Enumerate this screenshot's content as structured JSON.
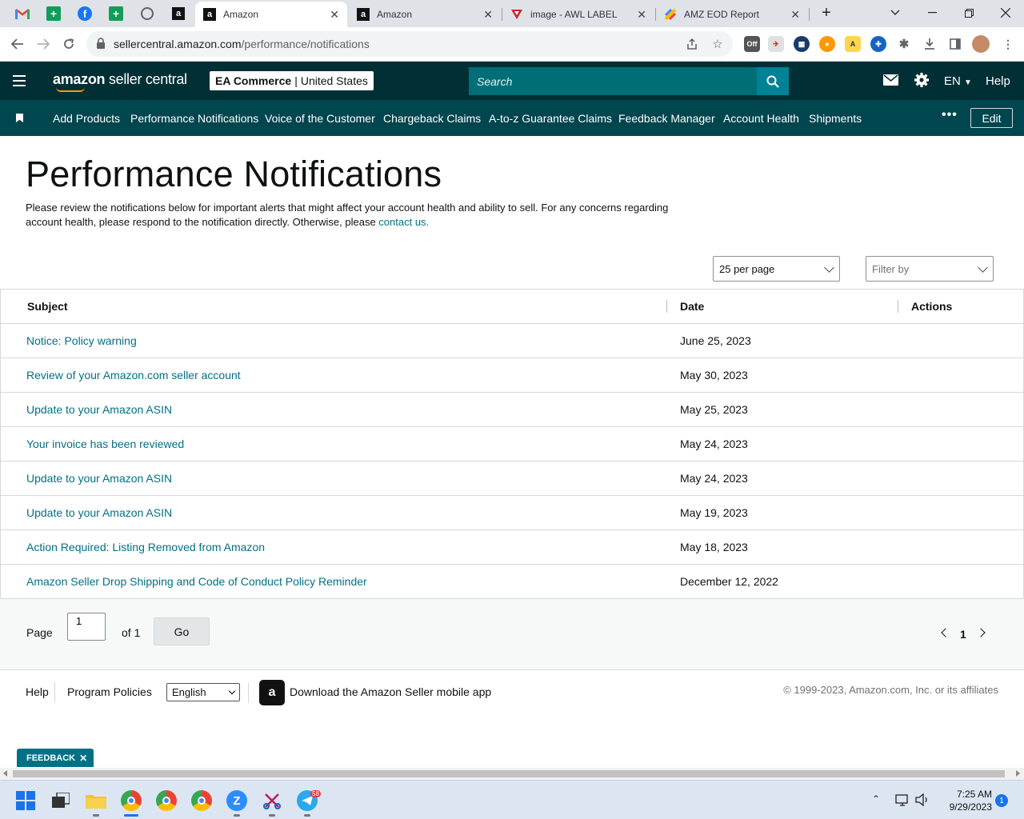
{
  "browser": {
    "tabs": [
      {
        "label": "Amazon",
        "active": true
      },
      {
        "label": "Amazon",
        "active": false
      },
      {
        "label": "image - AWL LABEL",
        "active": false
      },
      {
        "label": "AMZ EOD Report",
        "active": false
      }
    ],
    "url_host": "sellercentral.amazon.com",
    "url_path": "/performance/notifications"
  },
  "header": {
    "logo_word1": "amazon",
    "logo_word2": " seller central",
    "store_name": "EA Commerce",
    "store_sep": "|",
    "store_region": "United States",
    "search_placeholder": "Search",
    "language": "EN",
    "help": "Help"
  },
  "nav": {
    "items": [
      "Add Products",
      "Performance Notifications",
      "Voice of the Customer",
      "Chargeback Claims",
      "A-to-z Guarantee Claims",
      "Feedback Manager",
      "Account Health",
      "Shipments"
    ],
    "more": "•••",
    "edit": "Edit"
  },
  "main": {
    "title": "Performance Notifications",
    "intro_text": "Please review the notifications below for important alerts that might affect your account health and ability to sell. For any concerns regarding account health, please respond to the notification directly. Otherwise, please ",
    "intro_link": "contact us.",
    "per_page": "25 per page",
    "filter_placeholder": "Filter by",
    "columns": {
      "subject": "Subject",
      "date": "Date",
      "actions": "Actions"
    },
    "rows": [
      {
        "subject": "Notice: Policy warning",
        "date": "June 25, 2023"
      },
      {
        "subject": "Review of your Amazon.com seller account",
        "date": "May 30, 2023"
      },
      {
        "subject": "Update to your Amazon ASIN",
        "date": "May 25, 2023"
      },
      {
        "subject": "Your invoice has been reviewed",
        "date": "May 24, 2023"
      },
      {
        "subject": "Update to your Amazon ASIN",
        "date": "May 24, 2023"
      },
      {
        "subject": "Update to your Amazon ASIN",
        "date": "May 19, 2023"
      },
      {
        "subject": "Action Required: Listing Removed from Amazon",
        "date": "May 18, 2023"
      },
      {
        "subject": "Amazon Seller Drop Shipping and Code of Conduct Policy Reminder",
        "date": "December 12, 2022"
      }
    ],
    "pager": {
      "page_label": "Page",
      "page_value": "1",
      "of_label": "of 1",
      "go": "Go",
      "current": "1"
    }
  },
  "footer": {
    "help": "Help",
    "program_policies": "Program Policies",
    "language": "English",
    "app_text": "Download the Amazon Seller mobile app",
    "copyright": "© 1999-2023, Amazon.com, Inc. or its affiliates"
  },
  "feedback": {
    "label": "FEEDBACK",
    "close": "✕"
  },
  "taskbar": {
    "time": "7:25 AM",
    "date": "9/29/2023",
    "notifications": "1",
    "telegram_badge": "58"
  },
  "colors": {
    "header_bg": "#002f36",
    "nav_bg": "#00464f",
    "link": "#007185",
    "search_bg": "#006e76"
  }
}
